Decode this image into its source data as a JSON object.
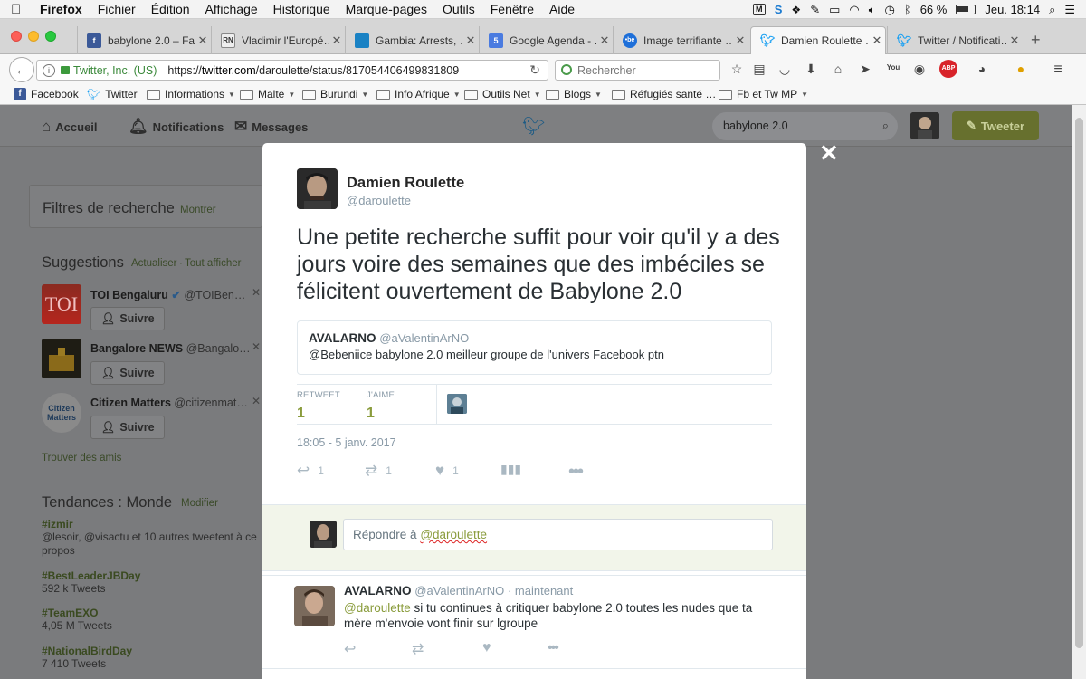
{
  "menubar": {
    "items": [
      "Firefox",
      "Fichier",
      "Édition",
      "Affichage",
      "Historique",
      "Marque-pages",
      "Outils",
      "Fenêtre",
      "Aide"
    ],
    "battery": "66 %",
    "clock": "Jeu. 18:14"
  },
  "tabs": [
    {
      "title": "babylone 2.0 – Fa…",
      "fav": "f",
      "color": "#3b5998"
    },
    {
      "title": "Vladimir l'Europé…",
      "fav": "RN",
      "color": "#777"
    },
    {
      "title": "Gambia: Arrests, …",
      "fav": "",
      "color": "#1a82c4"
    },
    {
      "title": "Google Agenda - …",
      "fav": "5",
      "color": "#4a7be0"
    },
    {
      "title": "Image terrifiante …",
      "fav": "•be",
      "color": "#1e6fd9"
    },
    {
      "title": "Damien Roulette …",
      "fav": "🐦",
      "color": "#ffffff"
    },
    {
      "title": "Twitter / Notificati…",
      "fav": "🐦",
      "color": "#ffffff"
    }
  ],
  "nav": {
    "identity": "Twitter, Inc. (US)",
    "url_prefix": "https://",
    "url_host": "twitter.com",
    "url_path": "/daroulette/status/817054406499831809",
    "search_placeholder": "Rechercher"
  },
  "bookmarks": [
    {
      "label": "Facebook",
      "type": "fb"
    },
    {
      "label": "Twitter",
      "type": "tw"
    },
    {
      "label": "Informations",
      "type": "folder"
    },
    {
      "label": "Malte",
      "type": "folder"
    },
    {
      "label": "Burundi",
      "type": "folder"
    },
    {
      "label": "Info Afrique",
      "type": "folder"
    },
    {
      "label": "Outils Net",
      "type": "folder"
    },
    {
      "label": "Blogs",
      "type": "folder"
    },
    {
      "label": "Réfugiés santé …",
      "type": "folder"
    },
    {
      "label": "Fb et Tw MP",
      "type": "folder"
    }
  ],
  "twitter_nav": {
    "home": "Accueil",
    "notifications": "Notifications",
    "messages": "Messages",
    "search_value": "babylone 2.0",
    "tweet_button": "Tweeter"
  },
  "sidebar": {
    "filters_title": "Filtres de recherche",
    "filters_show": "Montrer",
    "suggestions_title": "Suggestions",
    "refresh": "Actualiser",
    "show_all": "Tout afficher",
    "follow_label": "Suivre",
    "suggestions": [
      {
        "name": "TOI Bengaluru",
        "handle": "@TOIBen…",
        "avatar_text": "TOI"
      },
      {
        "name": "Bangalore NEWS",
        "handle": "@Bangalo…",
        "avatar_text": ""
      },
      {
        "name": "Citizen Matters",
        "handle": "@citizenmat…",
        "avatar_text": "Citizen Matters"
      }
    ],
    "find_friends": "Trouver des amis",
    "trends_title": "Tendances : Monde",
    "trends_modify": "Modifier",
    "trends": [
      {
        "tag": "#izmir",
        "desc": "@lesoir, @visactu et 10 autres tweetent à ce propos"
      },
      {
        "tag": "#BestLeaderJBDay",
        "desc": "592 k Tweets"
      },
      {
        "tag": "#TeamEXO",
        "desc": "4,05 M Tweets"
      },
      {
        "tag": "#NationalBirdDay",
        "desc": "7 410 Tweets"
      }
    ]
  },
  "tweet": {
    "author_name": "Damien Roulette",
    "author_handle": "@daroulette",
    "text": "Une petite recherche suffit pour voir qu'il y a des jours voire des semaines que des imbéciles se félicitent ouvertement de Babylone 2.0",
    "quote": {
      "name": "AVALARNO",
      "handle": "@aValentinArNO",
      "text": "@Bebeniice babylone 2.0 meilleur groupe de l'univers Facebook ptn"
    },
    "retweet_label": "RETWEET",
    "retweet_count": "1",
    "like_label": "J'AIME",
    "like_count": "1",
    "timestamp": "18:05 - 5 janv. 2017",
    "actions": {
      "reply": "1",
      "retweet": "1",
      "like": "1"
    }
  },
  "reply_box": {
    "prefix": "Répondre à ",
    "mention": "@daroulette"
  },
  "reply": {
    "name": "AVALARNO",
    "handle": "@aValentinArNO",
    "time": "· maintenant",
    "mention": "@daroulette",
    "text": " si tu continues à critiquer babylone 2.0 toutes les nudes que ta mère m'envoie vont finir sur lgroupe"
  }
}
